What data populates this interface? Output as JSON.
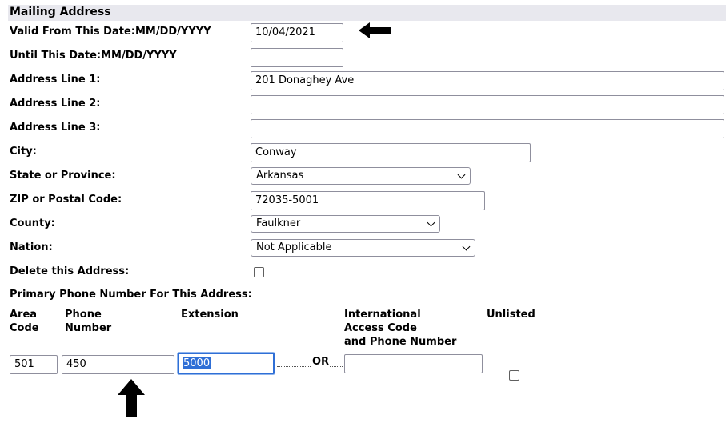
{
  "section_title": "Mailing Address",
  "fields": {
    "valid_from": {
      "label": "Valid From This Date:MM/DD/YYYY",
      "value": "10/04/2021"
    },
    "until": {
      "label": "Until This Date:MM/DD/YYYY",
      "value": ""
    },
    "address1": {
      "label": "Address Line 1:",
      "value": "201 Donaghey Ave"
    },
    "address2": {
      "label": "Address Line 2:",
      "value": ""
    },
    "address3": {
      "label": "Address Line 3:",
      "value": ""
    },
    "city": {
      "label": "City:",
      "value": "Conway"
    },
    "state": {
      "label": "State or Province:",
      "value": "Arkansas"
    },
    "zip": {
      "label": "ZIP or Postal Code:",
      "value": "72035-5001"
    },
    "county": {
      "label": "County:",
      "value": "Faulkner"
    },
    "nation": {
      "label": "Nation:",
      "value": "Not Applicable"
    },
    "delete": {
      "label": "Delete this Address:",
      "checked": false
    }
  },
  "phone": {
    "heading": "Primary Phone Number For This Address:",
    "col_area_1": "Area",
    "col_area_2": "Code",
    "col_phone_1": "Phone",
    "col_phone_2": "Number",
    "col_ext": "Extension",
    "col_intl_1": "International",
    "col_intl_2": "Access Code",
    "col_intl_3": "and Phone Number",
    "col_unlisted": "Unlisted",
    "area_value": "501",
    "number_value": "450",
    "ext_value": "5000",
    "or_label": "OR",
    "intl_value": "",
    "unlisted_checked": false
  }
}
